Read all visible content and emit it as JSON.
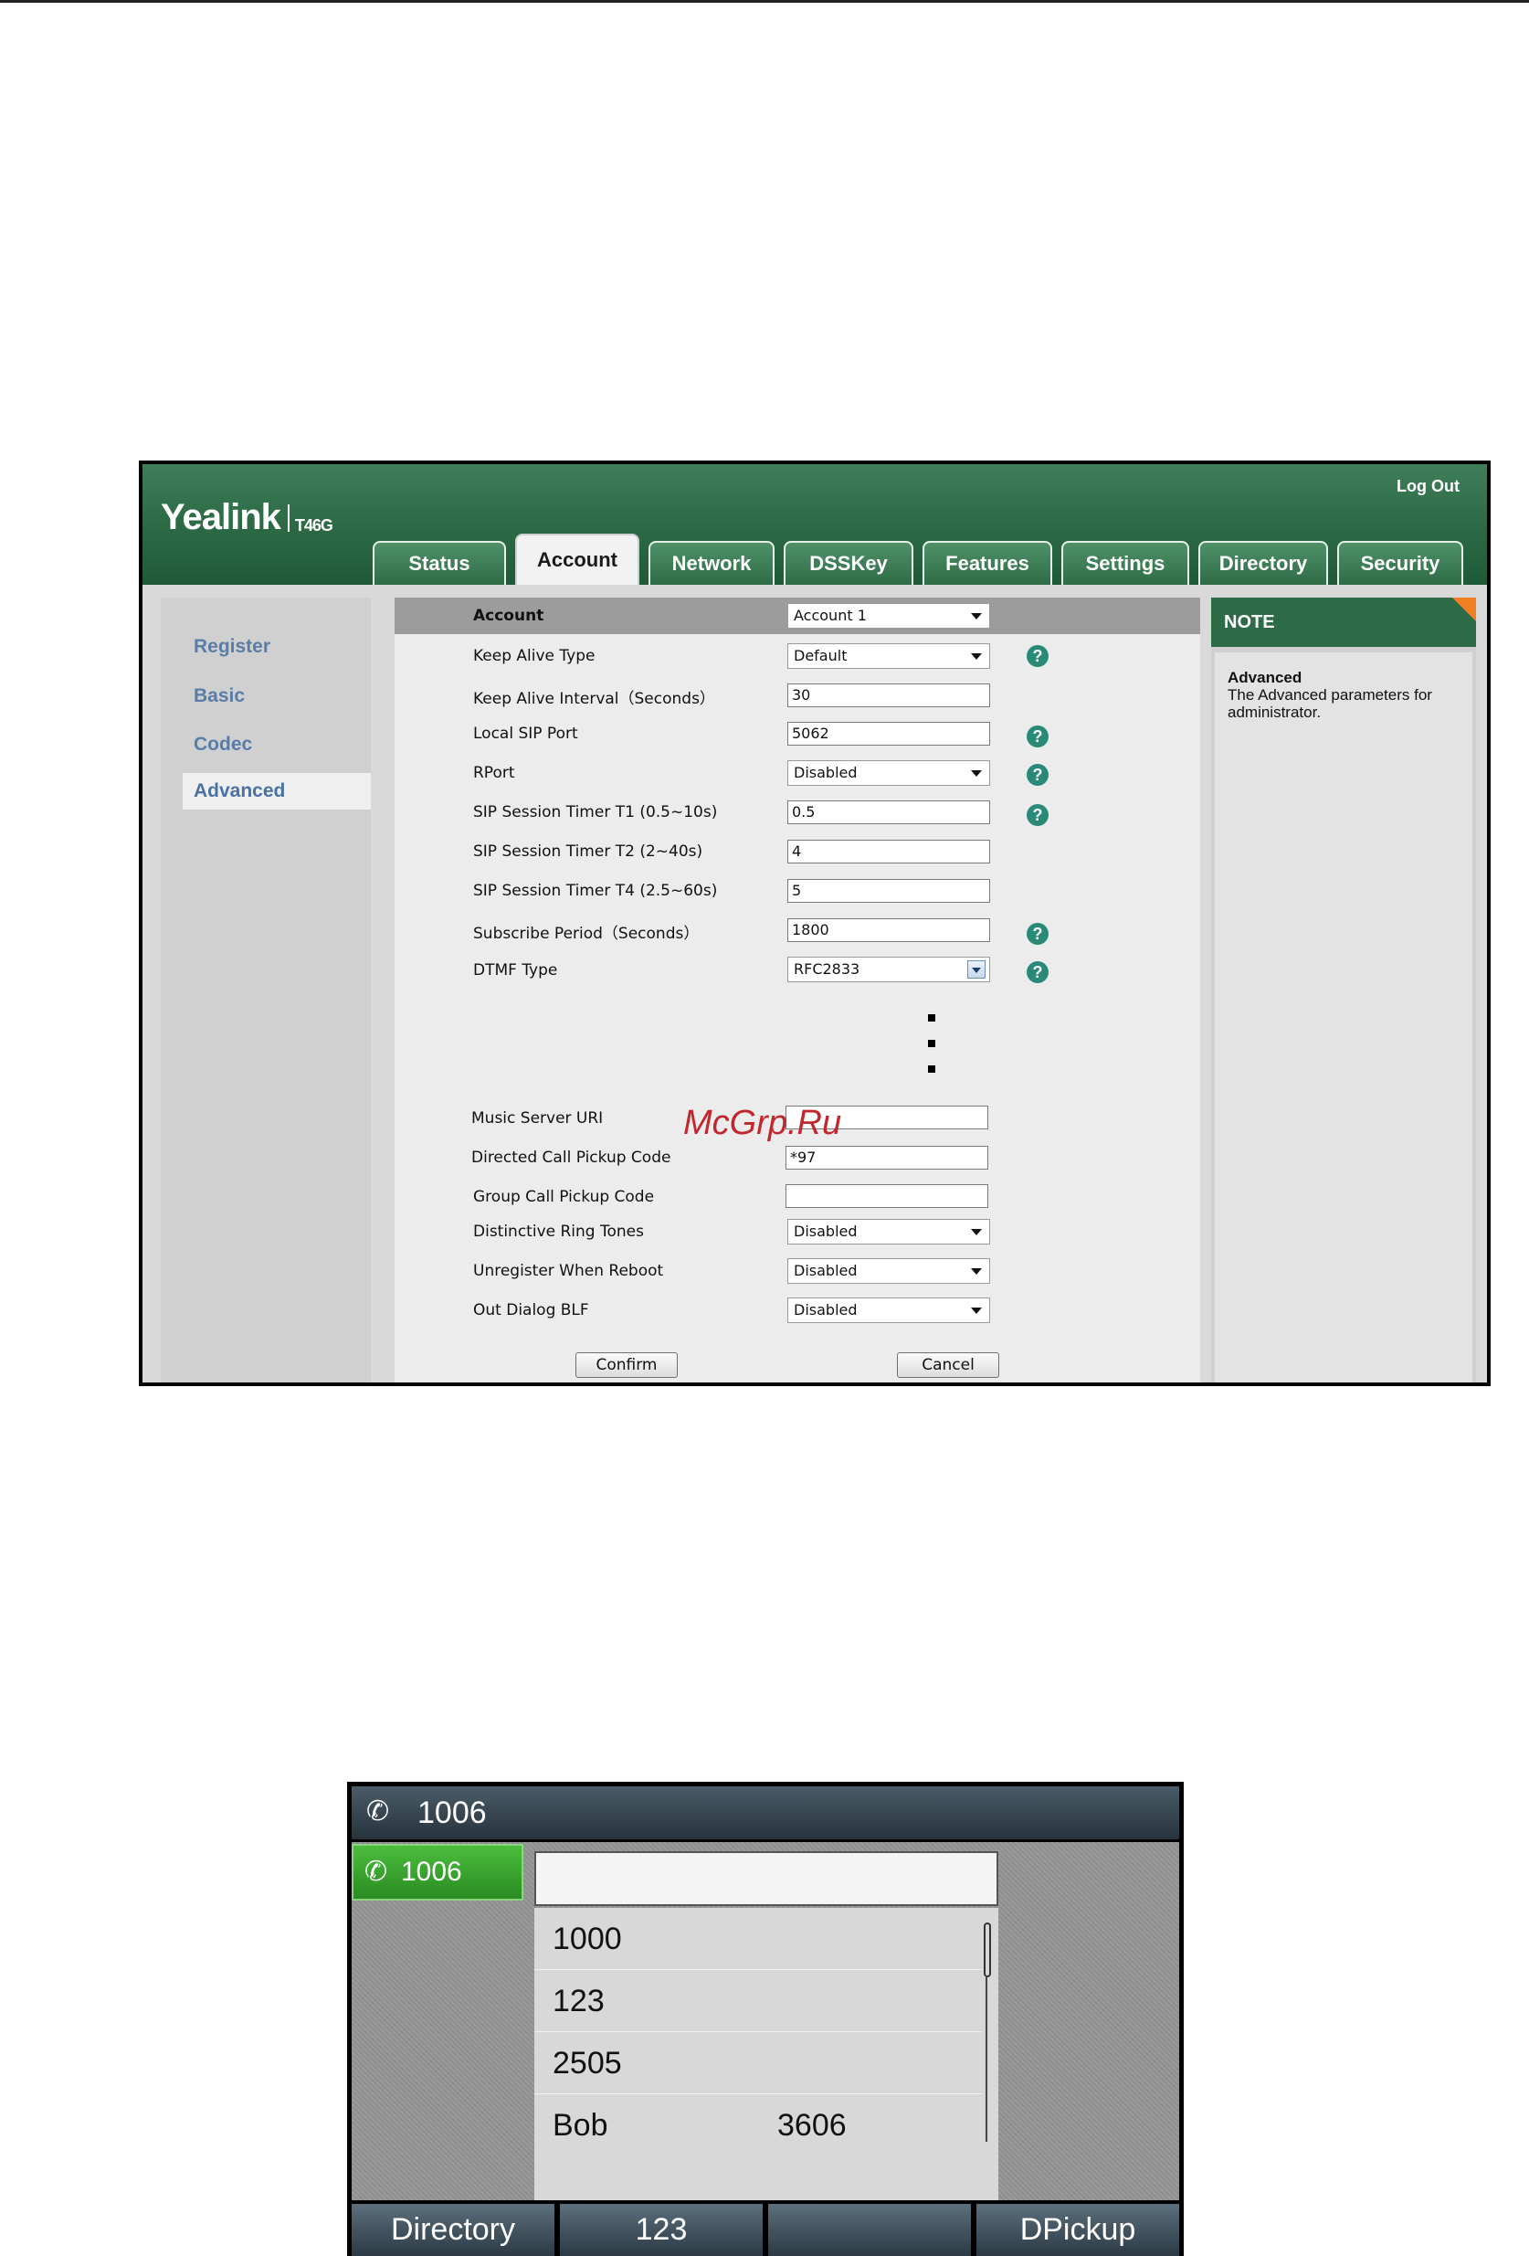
{
  "web": {
    "brand": "Yealink",
    "model": "T46G",
    "logout": "Log Out",
    "tabs": [
      "Status",
      "Account",
      "Network",
      "DSSKey",
      "Features",
      "Settings",
      "Directory",
      "Security"
    ],
    "active_tab": "Account",
    "sidebar": [
      "Register",
      "Basic",
      "Codec",
      "Advanced"
    ],
    "active_sidebar": "Advanced",
    "form": {
      "account_label": "Account",
      "account_value": "Account 1",
      "rows": [
        {
          "label": "Keep Alive Type",
          "value": "Default",
          "type": "select",
          "help": true
        },
        {
          "label": "Keep Alive Interval（Seconds）",
          "value": "30",
          "type": "input",
          "help": false
        },
        {
          "label": "Local SIP Port",
          "value": "5062",
          "type": "input",
          "help": true
        },
        {
          "label": "RPort",
          "value": "Disabled",
          "type": "select",
          "help": true
        },
        {
          "label": "SIP Session Timer T1 (0.5~10s)",
          "value": "0.5",
          "type": "input",
          "help": true
        },
        {
          "label": "SIP Session Timer T2 (2~40s)",
          "value": "4",
          "type": "input",
          "help": false
        },
        {
          "label": "SIP Session Timer T4 (2.5~60s)",
          "value": "5",
          "type": "input",
          "help": false
        },
        {
          "label": "Subscribe Period（Seconds）",
          "value": "1800",
          "type": "input",
          "help": true
        },
        {
          "label": "DTMF Type",
          "value": "RFC2833",
          "type": "select-focused",
          "help": true
        }
      ],
      "rows2": [
        {
          "label": "Music Server URI",
          "value": "",
          "type": "input"
        },
        {
          "label": "Directed Call Pickup Code",
          "value": "*97",
          "type": "input"
        },
        {
          "label": "Group Call Pickup Code",
          "value": "",
          "type": "input"
        },
        {
          "label": "Distinctive Ring Tones",
          "value": "Disabled",
          "type": "select"
        },
        {
          "label": "Unregister When Reboot",
          "value": "Disabled",
          "type": "select"
        },
        {
          "label": "Out Dialog BLF",
          "value": "Disabled",
          "type": "select"
        }
      ],
      "confirm": "Confirm",
      "cancel": "Cancel"
    },
    "note": {
      "header": "NOTE",
      "title": "Advanced",
      "text": "The Advanced parameters for administrator."
    },
    "watermark": "McGrp.Ru"
  },
  "phone": {
    "title_number": "1006",
    "line_key": "1006",
    "search_value": "",
    "entries": [
      {
        "name": "1000",
        "number": ""
      },
      {
        "name": "123",
        "number": ""
      },
      {
        "name": "2505",
        "number": ""
      },
      {
        "name": "Bob",
        "number": "3606"
      }
    ],
    "softkeys": [
      "Directory",
      "123",
      "",
      "DPickup"
    ]
  },
  "colors": {
    "header_green": "#2f6e48",
    "accent_orange": "#f07f22",
    "help_teal": "#2a8a78",
    "line_green": "#3aa52f"
  }
}
